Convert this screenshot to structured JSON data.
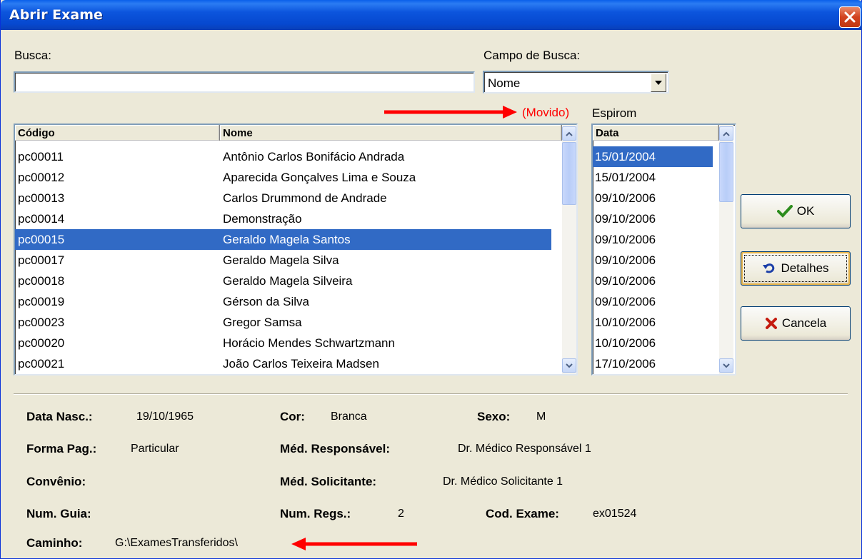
{
  "window": {
    "title": "Abrir Exame"
  },
  "search": {
    "label": "Busca:",
    "value": "",
    "field_label": "Campo de Busca:",
    "field_value": "Nome"
  },
  "annotations": {
    "moved": "(Movido)",
    "espirom": "Espirom"
  },
  "patients": {
    "headers": {
      "codigo": "Código",
      "nome": "Nome"
    },
    "rows": [
      {
        "codigo": "pc00011",
        "nome": "Antônio Carlos Bonifácio Andrada"
      },
      {
        "codigo": "pc00012",
        "nome": "Aparecida Gonçalves Lima e Souza"
      },
      {
        "codigo": "pc00013",
        "nome": "Carlos Drummond de Andrade"
      },
      {
        "codigo": "pc00014",
        "nome": "Demonstração"
      },
      {
        "codigo": "pc00015",
        "nome": "Geraldo Magela Santos"
      },
      {
        "codigo": "pc00017",
        "nome": "Geraldo Magela Silva"
      },
      {
        "codigo": "pc00018",
        "nome": "Geraldo Magela Silveira"
      },
      {
        "codigo": "pc00019",
        "nome": "Gérson da Silva"
      },
      {
        "codigo": "pc00023",
        "nome": "Gregor Samsa"
      },
      {
        "codigo": "pc00020",
        "nome": "Horácio Mendes Schwartzmann"
      },
      {
        "codigo": "pc00021",
        "nome": "João Carlos Teixeira Madsen"
      }
    ],
    "selected_index": 4
  },
  "exams": {
    "header": "Data",
    "rows": [
      "15/01/2004",
      "15/01/2004",
      "09/10/2006",
      "09/10/2006",
      "09/10/2006",
      "09/10/2006",
      "09/10/2006",
      "09/10/2006",
      "10/10/2006",
      "10/10/2006",
      "17/10/2006"
    ],
    "selected_index": 0
  },
  "buttons": {
    "ok": "OK",
    "detalhes": "Detalhes",
    "cancela": "Cancela"
  },
  "details": {
    "data_nasc_label": "Data Nasc.:",
    "data_nasc_value": "19/10/1965",
    "cor_label": "Cor:",
    "cor_value": "Branca",
    "sexo_label": "Sexo:",
    "sexo_value": "M",
    "forma_pag_label": "Forma Pag.:",
    "forma_pag_value": "Particular",
    "med_resp_label": "Méd. Responsável:",
    "med_resp_value": "Dr. Médico Responsável 1",
    "convenio_label": "Convênio:",
    "convenio_value": "",
    "med_sol_label": "Méd. Solicitante:",
    "med_sol_value": "Dr. Médico Solicitante 1",
    "num_guia_label": "Num. Guia:",
    "num_guia_value": "",
    "num_regs_label": "Num. Regs.:",
    "num_regs_value": "2",
    "cod_exame_label": "Cod. Exame:",
    "cod_exame_value": "ex01524",
    "caminho_label": "Caminho:",
    "caminho_value": "G:\\ExamesTransferidos\\"
  },
  "colors": {
    "selection": "#316ac5",
    "annotation": "#ff0000",
    "titlebar": "#0c55dd"
  }
}
